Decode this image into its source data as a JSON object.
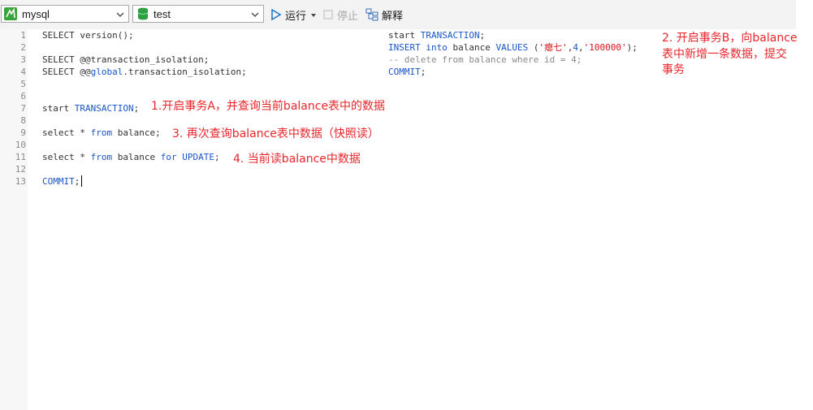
{
  "toolbar": {
    "connection_value": "mysql",
    "database_value": "test",
    "run_label": "运行",
    "stop_label": "停止",
    "explain_label": "解释"
  },
  "colors": {
    "keyword": "#1a56c8",
    "string": "#d6141b",
    "comment": "#8a8a8a",
    "annotation": "#e8262c",
    "mysql_icon": "#3aa33a",
    "db_icon": "#2ea043"
  },
  "gutter": {
    "line_numbers": [
      "1",
      "2",
      "3",
      "4",
      "5",
      "6",
      "7",
      "8",
      "9",
      "10",
      "11",
      "12",
      "13"
    ]
  },
  "editor_a": {
    "line1_text": "SELECT version();",
    "line3_kw": "SELECT",
    "line3_rest": " @@transaction_isolation;",
    "line4_kw": "SELECT",
    "line4_pre": " @@",
    "line4_global": "global",
    "line4_rest": ".transaction_isolation;",
    "line7_start": "start",
    "line7_tx": " TRANSACTION",
    "line7_end": ";",
    "line9_select": "select",
    "line9_mid": " * ",
    "line9_from": "from",
    "line9_rest": " balance;",
    "line11_select": "select",
    "line11_mid": " * ",
    "line11_from": "from",
    "line11_table": " balance ",
    "line11_for": "for",
    "line11_update": " UPDATE",
    "line11_end": ";",
    "line13_commit": "COMMIT",
    "line13_end": ";"
  },
  "editor_b": {
    "line1_start": "start",
    "line1_tx": " TRANSACTION",
    "line1_end": ";",
    "line2_insert": "INSERT",
    "line2_sp": " ",
    "line2_into": "into",
    "line2_table": " balance ",
    "line2_values": "VALUES",
    "line2_open": " (",
    "line2_str1": "'瘪七'",
    "line2_comma1": ",",
    "line2_num": "4",
    "line2_comma2": ",",
    "line2_str2": "'100000'",
    "line2_close": ");",
    "line3_comment": "-- delete from balance where id = 4;",
    "line4_commit": "COMMIT",
    "line4_end": ";"
  },
  "annotations": {
    "note1": "1.开启事务A，并查询当前balance表中的数据",
    "note2_line1": "2. 开启事务B，向balance",
    "note2_line2": "表中新增一条数据，提交",
    "note2_line3": "事务",
    "note3": "3. 再次查询balance表中数据（快照读）",
    "note4": "4. 当前读balance中数据"
  }
}
